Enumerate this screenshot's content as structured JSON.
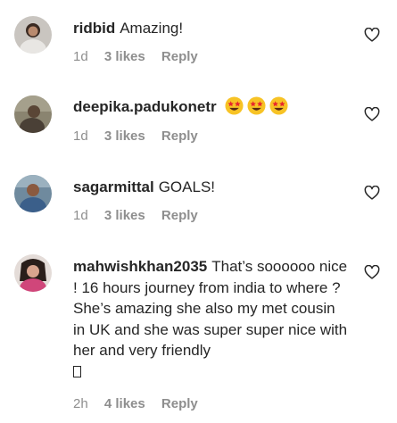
{
  "comments": [
    {
      "username": "ridbid",
      "text": "Amazing!",
      "time": "1d",
      "likes": "3 likes",
      "reply": "Reply"
    },
    {
      "username": "deepika.padukonetr",
      "text": "",
      "emoji": [
        "star-struck-emoji",
        "star-struck-emoji",
        "star-struck-emoji"
      ],
      "time": "1d",
      "likes": "3 likes",
      "reply": "Reply"
    },
    {
      "username": "sagarmittal",
      "text": "GOALS!",
      "time": "1d",
      "likes": "3 likes",
      "reply": "Reply"
    },
    {
      "username": "mahwishkhan2035",
      "text": "That’s soooooo nice ! 16 hours journey from india to where ? She’s amazing she also my met cousin in UK and she was super super nice with her and very friendly",
      "trailing_glyph": "missing-glyph-box",
      "time": "2h",
      "likes": "4 likes",
      "reply": "Reply"
    }
  ],
  "colors": {
    "text": "#262626",
    "meta": "#8e8e8e",
    "background": "#ffffff"
  },
  "icons": {
    "like": "heart-outline-icon"
  }
}
